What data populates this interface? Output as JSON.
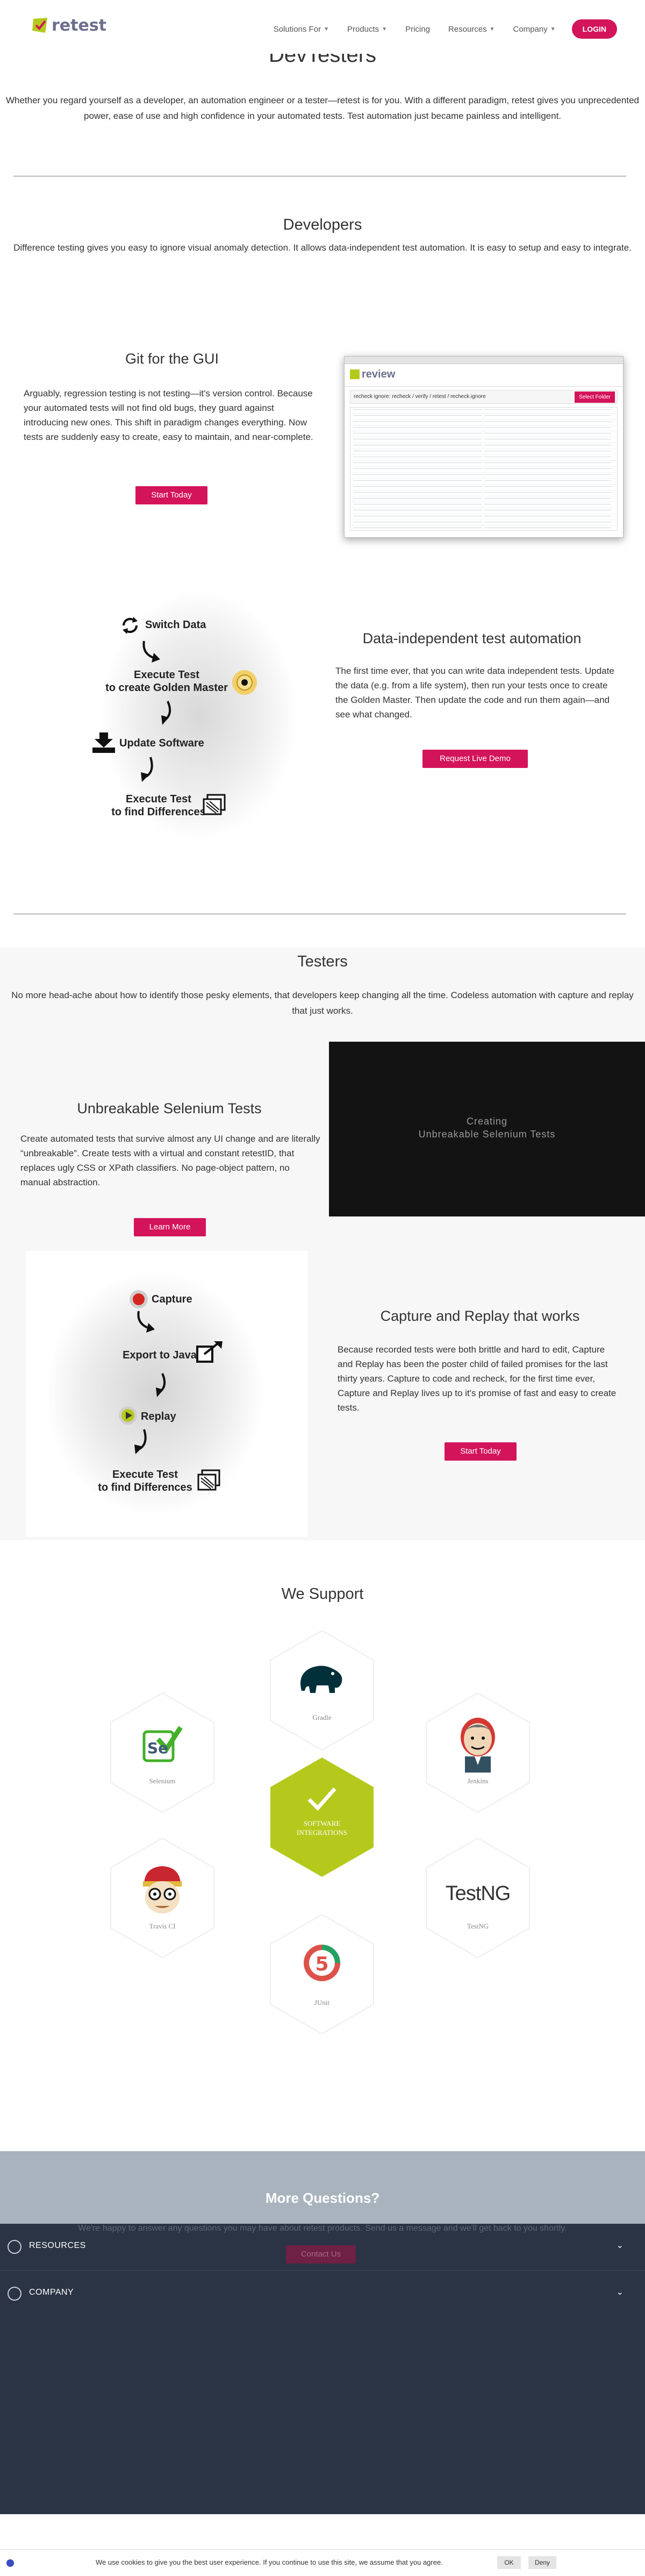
{
  "header": {
    "logo_text": "retest",
    "nav": [
      {
        "label": "Solutions For",
        "has_menu": true
      },
      {
        "label": "Products",
        "has_menu": true
      },
      {
        "label": "Pricing",
        "has_menu": false
      },
      {
        "label": "Resources",
        "has_menu": true
      },
      {
        "label": "Company",
        "has_menu": true
      }
    ],
    "login_label": "LOGIN"
  },
  "intro": {
    "title": "DevTesters",
    "text": "Whether you regard yourself as a developer, an automation engineer or a tester—retest is for you. With a different paradigm, retest gives you unprecedented power, ease of use and high confidence in your automated tests. Test automation just became painless and intelligent."
  },
  "developers": {
    "title": "Developers",
    "text": "Difference testing gives you easy to ignore visual anomaly detection. It allows data-independent test automation. It is easy to setup and easy to integrate."
  },
  "git": {
    "title": "Git for the GUI",
    "text": "Arguably, regression testing is not testing—it's version control. Because your automated tests will not find old bugs, they guard against introducing new ones. This shift in paradigm changes everything. Now tests are suddenly easy to create, easy to maintain, and near-complete.",
    "button": "Start Today",
    "shot_title": "review",
    "shot_path": "recheck ignore: recheck / verify / retest / recheck.ignore",
    "shot_button": "Select Folder"
  },
  "data_independent": {
    "title": "Data-independent test automation",
    "text": "The first time ever, that you can write data independent tests. Update the data (e.g. from a life system), then run your tests once to create the Golden Master. Then update the code and run them again—and see what changed.",
    "button": "Request Live Demo",
    "flow": {
      "step1": "Switch Data",
      "step2": "Execute Test\nto create Golden Master",
      "step3": "Update Software",
      "step4": "Execute Test\nto find Differences"
    }
  },
  "testers": {
    "title": "Testers",
    "text": "No more head-ache about how to identify those pesky elements, that developers keep changing all the time. Codeless automation with capture and replay that just works."
  },
  "selenium": {
    "title": "Unbreakable Selenium Tests",
    "text": "Create automated tests that survive almost any UI change and are literally “unbreakable”. Create tests with a virtual and constant retestID, that replaces ugly CSS or XPath classifiers. No page-object pattern, no manual abstraction.",
    "button": "Learn More",
    "video_line1": "Creating",
    "video_line2": "Unbreakable Selenium Tests"
  },
  "capture": {
    "title": "Capture and Replay that works",
    "text": "Because recorded tests were both brittle and hard to edit, Capture and Replay has been the poster child of failed promises for the last thirty years. Capture to code and recheck, for the first time ever, Capture and Replay lives up to it's promise of fast and easy to create tests.",
    "button": "Start Today",
    "flow": {
      "step1": "Capture",
      "step2": "Export to Java",
      "step3": "Replay",
      "step4": "Execute Test\nto find Differences"
    }
  },
  "support": {
    "title": "We Support",
    "center_label": "SOFTWARE INTEGRATIONS",
    "items": [
      {
        "name": "Gradle",
        "icon": "gradle-elephant-icon"
      },
      {
        "name": "Selenium",
        "icon": "selenium-icon"
      },
      {
        "name": "Jenkins",
        "icon": "jenkins-icon"
      },
      {
        "name": "Travis CI",
        "icon": "travis-ci-icon"
      },
      {
        "name": "TestNG",
        "icon": "testng-icon"
      },
      {
        "name": "JUnit",
        "icon": "junit-5-icon"
      }
    ],
    "testng_text": "TestNG",
    "junit_text": "5",
    "selenium_text": "Se"
  },
  "contact": {
    "title": "More Questions?",
    "text": "We're happy to answer any questions you may have about retest products. Send us a message and we'll get back to you shortly.",
    "button": "Contact Us"
  },
  "footer": {
    "sections": [
      "RESOURCES",
      "COMPANY"
    ]
  },
  "cookie": {
    "text": "We use cookies to give you the best user experience. If you continue to use this site, we assume that you agree.",
    "ok": "OK",
    "deny": "Deny"
  },
  "colors": {
    "brand_pink": "#d4145a",
    "brand_lime": "#b5c91c",
    "footer_dark": "#2b3444"
  }
}
